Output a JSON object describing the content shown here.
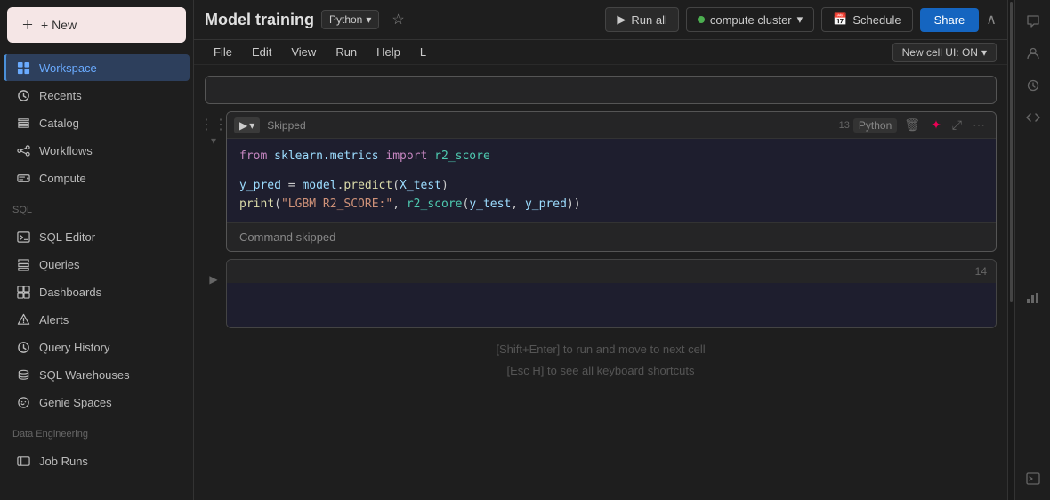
{
  "sidebar": {
    "new_button": "+ New",
    "nav_items": [
      {
        "id": "workspace",
        "label": "Workspace",
        "active": true
      },
      {
        "id": "recents",
        "label": "Recents",
        "active": false
      },
      {
        "id": "catalog",
        "label": "Catalog",
        "active": false
      },
      {
        "id": "workflows",
        "label": "Workflows",
        "active": false
      },
      {
        "id": "compute",
        "label": "Compute",
        "active": false
      }
    ],
    "sql_section": "SQL",
    "sql_items": [
      {
        "id": "sql-editor",
        "label": "SQL Editor"
      },
      {
        "id": "queries",
        "label": "Queries"
      },
      {
        "id": "dashboards",
        "label": "Dashboards"
      },
      {
        "id": "alerts",
        "label": "Alerts"
      },
      {
        "id": "query-history",
        "label": "Query History"
      },
      {
        "id": "sql-warehouses",
        "label": "SQL Warehouses"
      },
      {
        "id": "genie-spaces",
        "label": "Genie Spaces"
      }
    ],
    "data_eng_section": "Data Engineering",
    "data_eng_items": [
      {
        "id": "job-runs",
        "label": "Job Runs"
      }
    ]
  },
  "topbar": {
    "title": "Model training",
    "language": "Python",
    "run_all": "Run all",
    "cluster": "compute cluster",
    "schedule": "Schedule",
    "share": "Share",
    "new_cell_toggle": "New cell UI: ON"
  },
  "menu": {
    "items": [
      "File",
      "Edit",
      "View",
      "Run",
      "Help",
      "L"
    ]
  },
  "cells": [
    {
      "id": 13,
      "status": "Skipped",
      "language": "Python",
      "lines": [
        {
          "type": "code",
          "content": "from sklearn.metrics import r2_score"
        },
        {
          "type": "blank"
        },
        {
          "type": "code",
          "content": "y_pred = model.predict(X_test)"
        },
        {
          "type": "code",
          "content": "print(\"LGBM R2_SCORE:\", r2_score(y_test, y_pred))"
        }
      ],
      "output": "Command skipped"
    },
    {
      "id": 14,
      "status": "",
      "language": "",
      "lines": [],
      "output": ""
    }
  ],
  "hints": {
    "line1": "[Shift+Enter] to run and move to next cell",
    "line2": "[Esc H] to see all keyboard shortcuts"
  }
}
